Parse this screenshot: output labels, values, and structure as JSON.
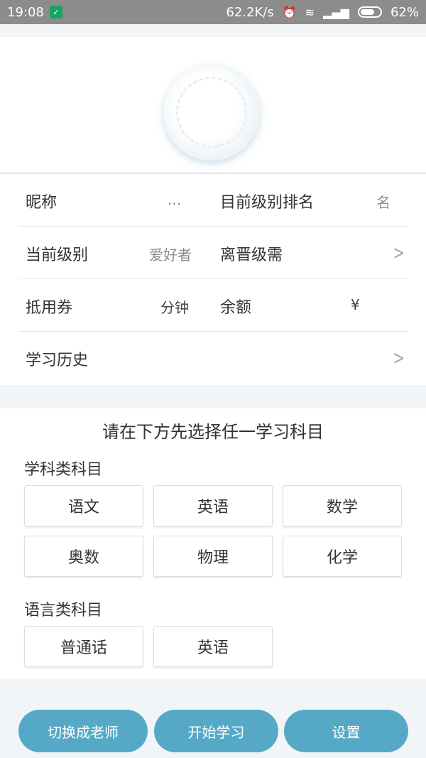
{
  "status_bar": {
    "time": "19:08",
    "speed": "62.2K/s",
    "battery": "62%",
    "icons": [
      "shield-icon",
      "alarm-icon",
      "wifi-icon",
      "signal-icon",
      "battery-icon"
    ]
  },
  "profile": {
    "nickname_label": "昵称",
    "nickname_value": "...",
    "rank_label": "目前级别排名",
    "rank_value": "名",
    "level_label": "当前级别",
    "level_value": "爱好者",
    "upgrade_label": "离晋级需",
    "coupon_label": "抵用券",
    "coupon_value": "分钟",
    "balance_label": "余额",
    "balance_value": "¥",
    "history_label": "学习历史"
  },
  "subjects": {
    "heading": "请在下方先选择任一学习科目",
    "academic_title": "学科类科目",
    "academic": [
      "语文",
      "英语",
      "数学",
      "奥数",
      "物理",
      "化学"
    ],
    "language_title": "语言类科目",
    "language": [
      "普通话",
      "英语"
    ]
  },
  "actions": {
    "switch_teacher": "切换成老师",
    "start_learning": "开始学习",
    "settings": "设置"
  },
  "colors": {
    "accent": "#56a9c6",
    "status_bar": "#8c8c8c"
  }
}
